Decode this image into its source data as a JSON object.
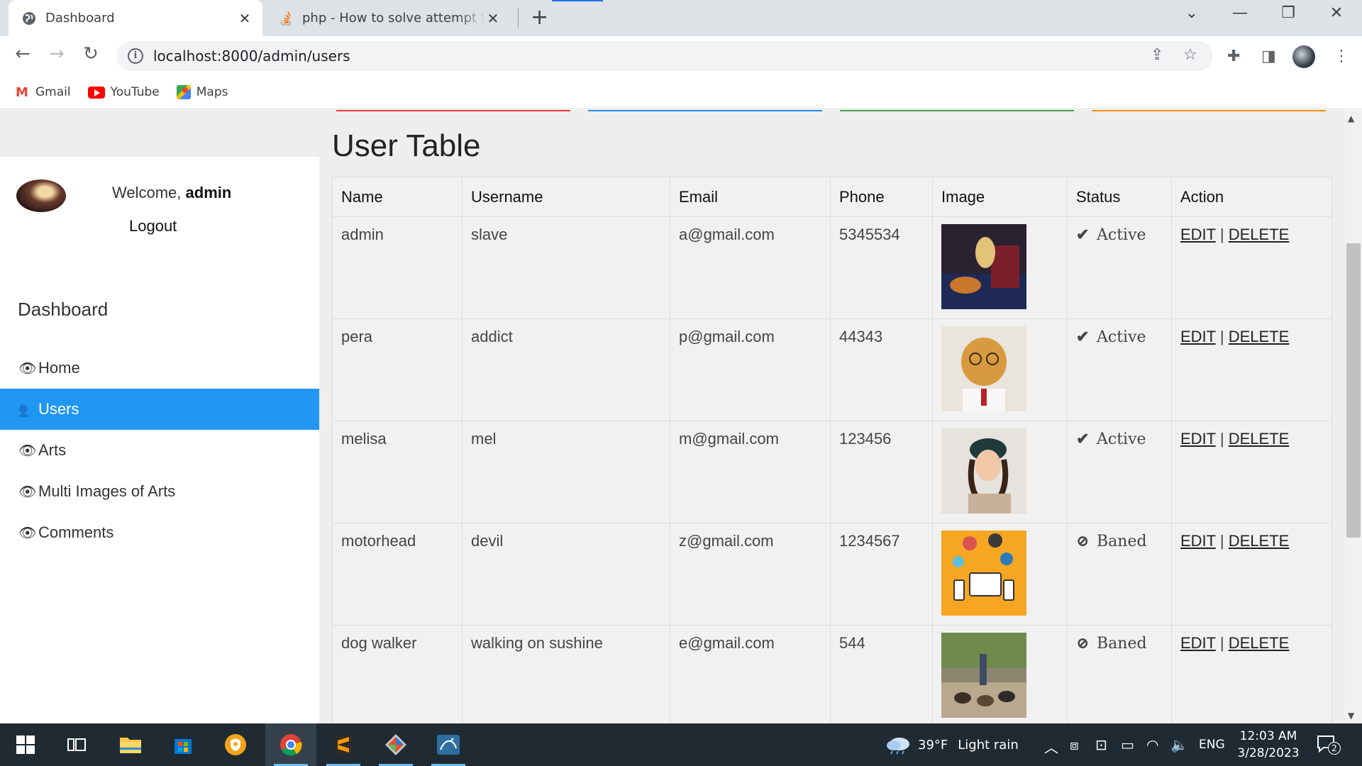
{
  "browser": {
    "tabs": [
      {
        "title": "Dashboard",
        "active": true,
        "icon": "globe-icon"
      },
      {
        "title": "php - How to solve attempt to read",
        "active": false,
        "icon": "stackoverflow-icon"
      }
    ],
    "url": "localhost:8000/admin/users",
    "bookmarks": [
      "Gmail",
      "YouTube",
      "Maps"
    ]
  },
  "sidebar": {
    "welcome_prefix": "Welcome,",
    "username": "admin",
    "logout": "Logout",
    "heading": "Dashboard",
    "items": [
      {
        "label": "Home",
        "icon": "eye-icon",
        "active": false
      },
      {
        "label": "Users",
        "icon": "users-icon",
        "active": true
      },
      {
        "label": "Arts",
        "icon": "eye-icon",
        "active": false
      },
      {
        "label": "Multi Images of Arts",
        "icon": "eye-icon",
        "active": false
      },
      {
        "label": "Comments",
        "icon": "eye-icon",
        "active": false
      }
    ]
  },
  "main": {
    "title": "User Table",
    "columns": [
      "Name",
      "Username",
      "Email",
      "Phone",
      "Image",
      "Status",
      "Action"
    ],
    "rows": [
      {
        "name": "admin",
        "username": "slave",
        "email": "a@gmail.com",
        "phone": "5345534",
        "status": "Active",
        "status_icon": "check-icon"
      },
      {
        "name": "pera",
        "username": "addict",
        "email": "p@gmail.com",
        "phone": "44343",
        "status": "Active",
        "status_icon": "check-icon"
      },
      {
        "name": "melisa",
        "username": "mel",
        "email": "m@gmail.com",
        "phone": "123456",
        "status": "Active",
        "status_icon": "check-icon"
      },
      {
        "name": "motorhead",
        "username": "devil",
        "email": "z@gmail.com",
        "phone": "1234567",
        "status": "Baned",
        "status_icon": "ban-icon"
      },
      {
        "name": "dog walker",
        "username": "walking on sushine",
        "email": "e@gmail.com",
        "phone": "544",
        "status": "Baned",
        "status_icon": "ban-icon"
      }
    ],
    "action_edit": "EDIT",
    "action_sep": "|",
    "action_delete": "DELETE"
  },
  "colors": {
    "accent": "#2196f3",
    "deco_lines": [
      "#e53935",
      "#1e88e5",
      "#43a047",
      "#fb8c00"
    ]
  },
  "taskbar": {
    "weather_temp": "39°F",
    "weather_desc": "Light rain",
    "lang": "ENG",
    "time": "12:03 AM",
    "date": "3/28/2023",
    "notif_count": "2"
  }
}
